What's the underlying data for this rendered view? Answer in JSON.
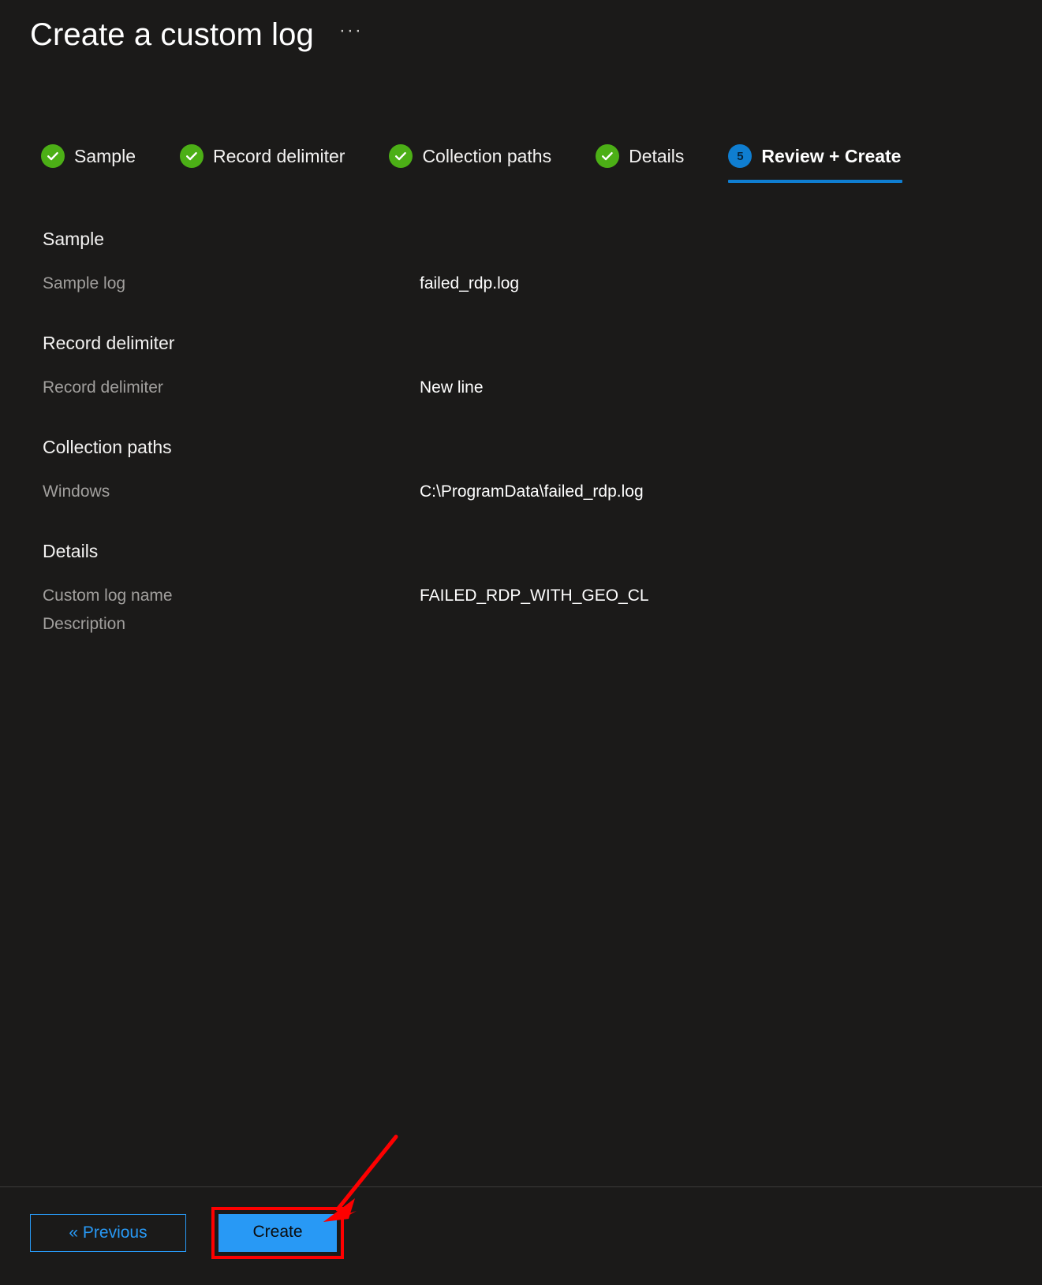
{
  "header": {
    "title": "Create a custom log",
    "more_menu": "···"
  },
  "wizard": {
    "tabs": [
      {
        "label": "Sample",
        "state": "done",
        "marker": "check-icon"
      },
      {
        "label": "Record delimiter",
        "state": "done",
        "marker": "check-icon"
      },
      {
        "label": "Collection paths",
        "state": "done",
        "marker": "check-icon"
      },
      {
        "label": "Details",
        "state": "done",
        "marker": "check-icon"
      },
      {
        "label": "Review + Create",
        "state": "current",
        "marker": "5"
      }
    ],
    "active_index": 4
  },
  "review": {
    "sections": [
      {
        "heading": "Sample",
        "rows": [
          {
            "label": "Sample log",
            "value": "failed_rdp.log"
          }
        ]
      },
      {
        "heading": "Record delimiter",
        "rows": [
          {
            "label": "Record delimiter",
            "value": "New line"
          }
        ]
      },
      {
        "heading": "Collection paths",
        "rows": [
          {
            "label": "Windows",
            "value": "C:\\ProgramData\\failed_rdp.log"
          }
        ]
      },
      {
        "heading": "Details",
        "rows": [
          {
            "label": "Custom log name",
            "value": "FAILED_RDP_WITH_GEO_CL"
          },
          {
            "label": "Description",
            "value": ""
          }
        ]
      }
    ]
  },
  "footer": {
    "previous_label": "« Previous",
    "create_label": "Create"
  },
  "colors": {
    "background": "#1b1a19",
    "accent_blue": "#0f7ed1",
    "button_blue": "#2899f5",
    "success_green": "#4caf16",
    "annotation_red": "#fe0000",
    "label_grey": "#a19f9d"
  }
}
